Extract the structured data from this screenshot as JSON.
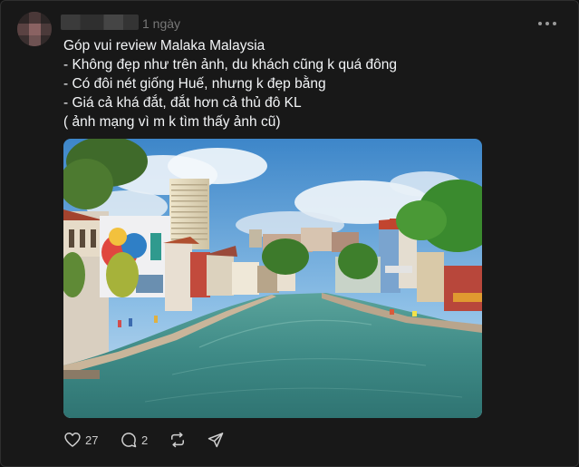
{
  "post": {
    "time_ago": "1 ngày",
    "text_lines": [
      "Góp vui review Malaka Malaysia",
      "- Không đẹp như trên ảnh, du khách cũng k quá đông",
      "- Có đôi nét giống Huế, nhưng k đẹp bằng",
      "- Giá cả khá đắt, đắt hơn cả thủ đô KL",
      "( ảnh mạng vì m k tìm thấy ảnh cũ)"
    ],
    "likes": "27",
    "replies": "2"
  },
  "icons": {
    "more": "more-horizontal-icon",
    "like": "heart-icon",
    "reply": "comment-icon",
    "repost": "repost-icon",
    "share": "send-icon"
  },
  "colors": {
    "background": "#181818",
    "text": "#f3f5f7",
    "muted": "#777777"
  }
}
